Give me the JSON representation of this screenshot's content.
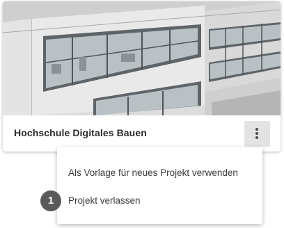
{
  "card": {
    "title": "Hochschule Digitales Bauen",
    "thumbnail_icon": "building-facade-image",
    "more_icon": "more-vertical-icon"
  },
  "menu": {
    "items": [
      {
        "label": "Als Vorlage für neues Projekt verwenden"
      },
      {
        "label": "Projekt verlassen"
      }
    ]
  },
  "step_badge": {
    "number": "1"
  },
  "colors": {
    "badge_bg": "#5a5a5a",
    "button_bg": "#e3e3e3",
    "text": "#2b2b2b"
  }
}
